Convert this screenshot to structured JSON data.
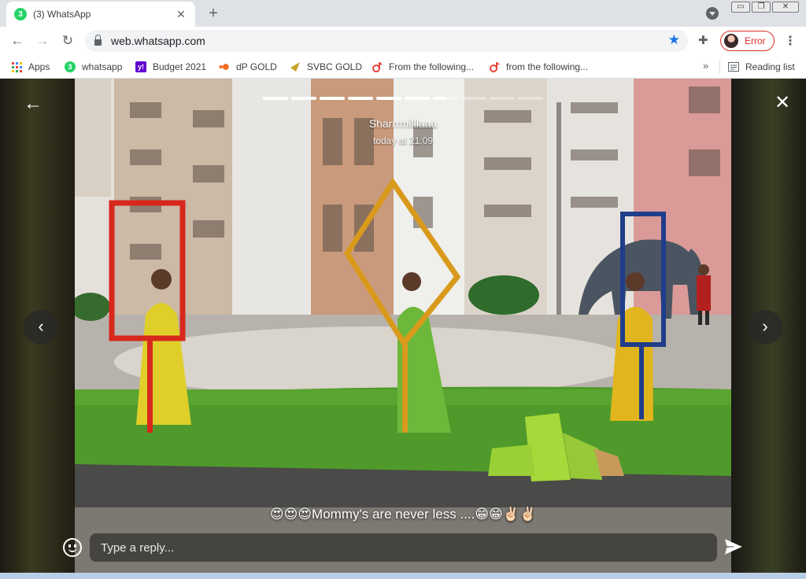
{
  "browser": {
    "tab": {
      "badge": "3",
      "title": "(3) WhatsApp",
      "close": "✕"
    },
    "new_tab": "+",
    "window_controls": [
      "▭",
      "❐",
      "✕"
    ],
    "url": "web.whatsapp.com",
    "profile_label": "Error",
    "bookmarks": [
      {
        "label": "Apps",
        "icon": "apps-grid-icon"
      },
      {
        "label": "whatsapp",
        "icon": "whatsapp-icon",
        "icon_text": "3",
        "color": "#25d366"
      },
      {
        "label": "Budget 2021",
        "icon": "yahoo-icon",
        "icon_text": "y!",
        "color": "#6001d2"
      },
      {
        "label": "dP GOLD",
        "icon": "dp-gold-icon",
        "color": "#f26b21"
      },
      {
        "label": "SVBC GOLD",
        "icon": "svbc-icon",
        "color": "#c9a227"
      },
      {
        "label": "From the following...",
        "icon": "tiktok-icon",
        "color": "#e8453c"
      },
      {
        "label": "from the following...",
        "icon": "tiktok-icon",
        "color": "#e8453c"
      }
    ],
    "more_bookmarks": "»",
    "reading_list": "Reading list"
  },
  "status": {
    "poster_name": "Sharrrmilllaaa",
    "time": "today at 21:09",
    "progress": {
      "total": 10,
      "completed": 6,
      "current_fraction": 0.55
    },
    "caption": "😍😍😍Mommy's are never less ....😁😁✌🏻✌🏻",
    "reply_placeholder": "Type a reply...",
    "back_glyph": "←",
    "close_glyph": "✕",
    "prev_glyph": "‹",
    "next_glyph": "›"
  },
  "colors": {
    "accent": "#1a73e8",
    "whatsapp_green": "#25d366",
    "error_red": "#d93025"
  }
}
